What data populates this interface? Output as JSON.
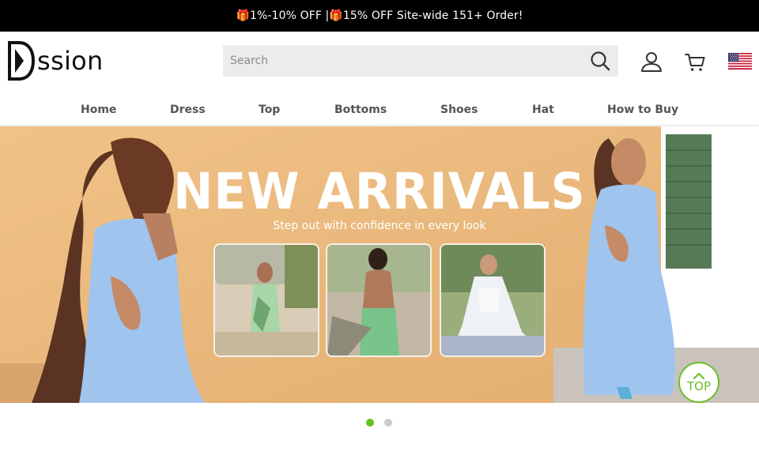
{
  "promo": {
    "text": "🎁1%-10% OFF |🎁15% OFF Site-wide 151+ Order!"
  },
  "header": {
    "logo_text": "ssion",
    "search_placeholder": "Search",
    "flag": "us-flag-icon"
  },
  "nav": {
    "items": [
      {
        "label": "Home"
      },
      {
        "label": "Dress"
      },
      {
        "label": "Top"
      },
      {
        "label": "Bottoms"
      },
      {
        "label": "Shoes"
      },
      {
        "label": "Hat"
      },
      {
        "label": "How to Buy"
      }
    ]
  },
  "banner": {
    "title": "NEW ARRIVALS",
    "subtitle": "Step out with confidence in every look",
    "slide_count": 2,
    "active_slide": 1
  },
  "back_to_top": {
    "label": "TOP"
  },
  "colors": {
    "promo_bg": "#000000",
    "accent_green": "#67c21c",
    "banner_bg": "#e8b77a",
    "dress_blue": "#9fc4ee"
  }
}
